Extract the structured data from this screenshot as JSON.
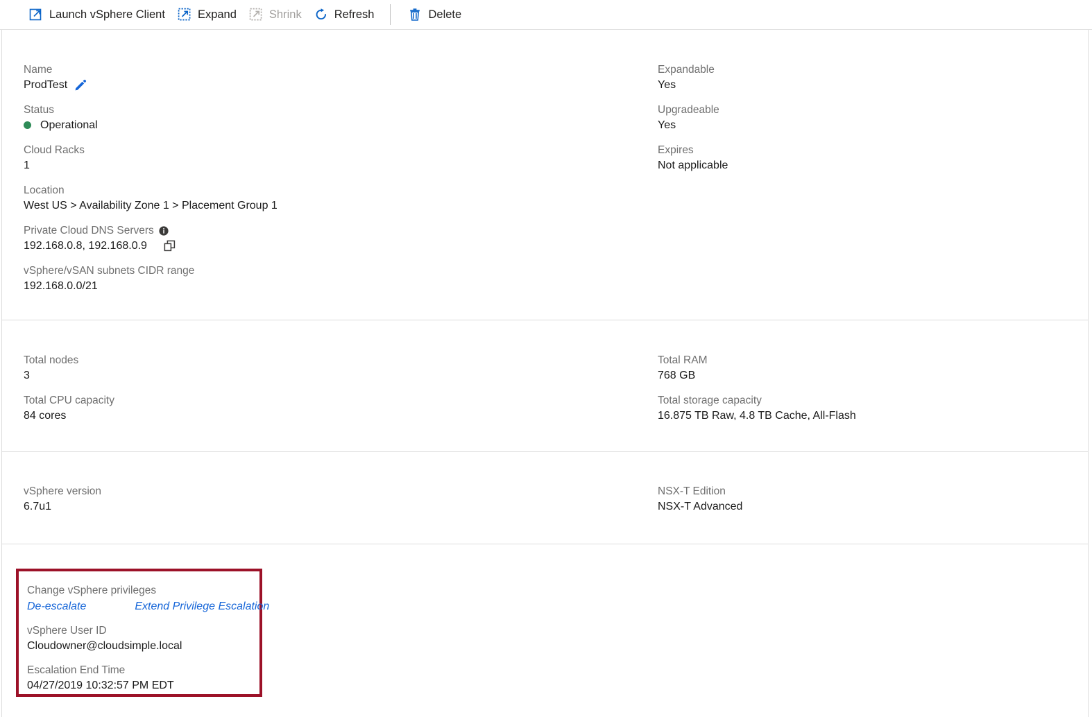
{
  "toolbar": {
    "buttons": [
      {
        "label": "Launch vSphere Client",
        "icon": "external-link-icon",
        "disabled": false
      },
      {
        "label": "Expand",
        "icon": "expand-icon",
        "disabled": false
      },
      {
        "label": "Shrink",
        "icon": "shrink-icon",
        "disabled": true
      },
      {
        "label": "Refresh",
        "icon": "refresh-icon",
        "disabled": false
      },
      {
        "label": "Delete",
        "icon": "trash-icon",
        "disabled": false
      }
    ]
  },
  "colors": {
    "accent": "#0078d4",
    "link": "#1565d8",
    "status_operational": "#2e8b57",
    "highlight_border": "#9c1128",
    "disabled": "#a19f9d"
  },
  "overview": {
    "name": {
      "label": "Name",
      "value": "ProdTest",
      "edit_icon": "pencil-icon"
    },
    "status": {
      "label": "Status",
      "value": "Operational",
      "indicator": "status-dot-green"
    },
    "cloud_racks": {
      "label": "Cloud Racks",
      "value": "1"
    },
    "location": {
      "label": "Location",
      "value": "West US > Availability Zone 1 > Placement Group 1"
    },
    "dns_servers": {
      "label": "Private Cloud DNS Servers",
      "value": "192.168.0.8, 192.168.0.9",
      "info_icon": "info-icon",
      "copy_icon": "copy-icon"
    },
    "cidr": {
      "label": "vSphere/vSAN subnets CIDR range",
      "value": "192.168.0.0/21"
    },
    "expandable": {
      "label": "Expandable",
      "value": "Yes"
    },
    "upgradeable": {
      "label": "Upgradeable",
      "value": "Yes"
    },
    "expires": {
      "label": "Expires",
      "value": "Not applicable"
    }
  },
  "capacity": {
    "total_nodes": {
      "label": "Total nodes",
      "value": "3"
    },
    "total_cpu": {
      "label": "Total CPU capacity",
      "value": "84 cores"
    },
    "total_ram": {
      "label": "Total RAM",
      "value": "768 GB"
    },
    "total_storage": {
      "label": "Total storage capacity",
      "value": "16.875 TB Raw, 4.8 TB Cache, All-Flash"
    }
  },
  "software": {
    "vsphere_version": {
      "label": "vSphere version",
      "value": "6.7u1"
    },
    "nsxt_edition": {
      "label": "NSX-T Edition",
      "value": "NSX-T Advanced"
    }
  },
  "privileges": {
    "change_label": "Change vSphere privileges",
    "de_escalate_link": "De-escalate",
    "extend_link": "Extend Privilege Escalation",
    "user_id": {
      "label": "vSphere User ID",
      "value": "Cloudowner@cloudsimple.local"
    },
    "escalation_end_time": {
      "label": "Escalation End Time",
      "value": "04/27/2019 10:32:57 PM EDT"
    }
  }
}
